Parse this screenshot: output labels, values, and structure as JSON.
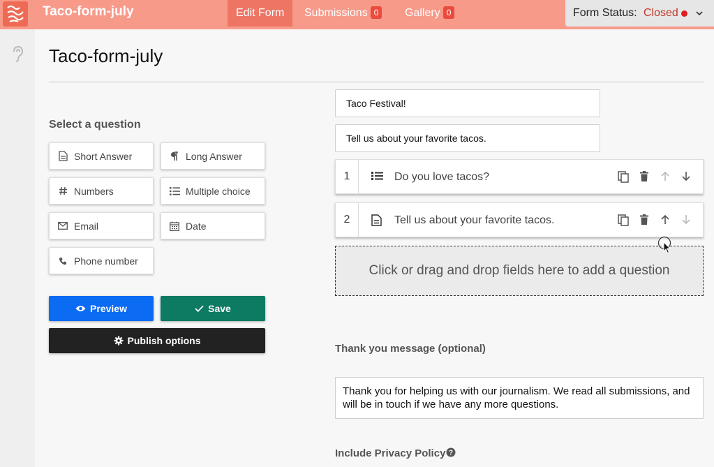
{
  "header": {
    "app_title": "Taco-form-july",
    "tabs": [
      {
        "label": "Edit Form"
      },
      {
        "label": "Submissions",
        "badge": "0"
      },
      {
        "label": "Gallery",
        "badge": "0"
      }
    ],
    "status_label": "Form Status:",
    "status_value": "Closed",
    "accent_color": "#f79a8a"
  },
  "page": {
    "title": "Taco-form-july"
  },
  "question_picker": {
    "label": "Select a question",
    "types": [
      {
        "label": "Short Answer",
        "icon": "document-icon"
      },
      {
        "label": "Long Answer",
        "icon": "paragraph-icon"
      },
      {
        "label": "Numbers",
        "icon": "hash-icon"
      },
      {
        "label": "Multiple choice",
        "icon": "list-icon"
      },
      {
        "label": "Email",
        "icon": "envelope-icon"
      },
      {
        "label": "Date",
        "icon": "calendar-icon"
      },
      {
        "label": "Phone number",
        "icon": "phone-icon"
      }
    ]
  },
  "actions": {
    "preview_label": "Preview",
    "save_label": "Save",
    "publish_label": "Publish options"
  },
  "form": {
    "heading_value": "Taco Festival!",
    "description_value": "Tell us about your favorite tacos.",
    "questions": [
      {
        "number": "1",
        "text": "Do you love tacos?",
        "icon": "list-icon"
      },
      {
        "number": "2",
        "text": "Tell us about your favorite tacos.",
        "icon": "document-icon"
      }
    ],
    "dropzone_text": "Click or drag and drop fields here to add a question",
    "thanks_label": "Thank you message (optional)",
    "thanks_value": "Thank you for helping us with our journalism. We read all submissions, and will be in touch if we have any more questions.",
    "privacy_label": "Include Privacy Policy"
  }
}
